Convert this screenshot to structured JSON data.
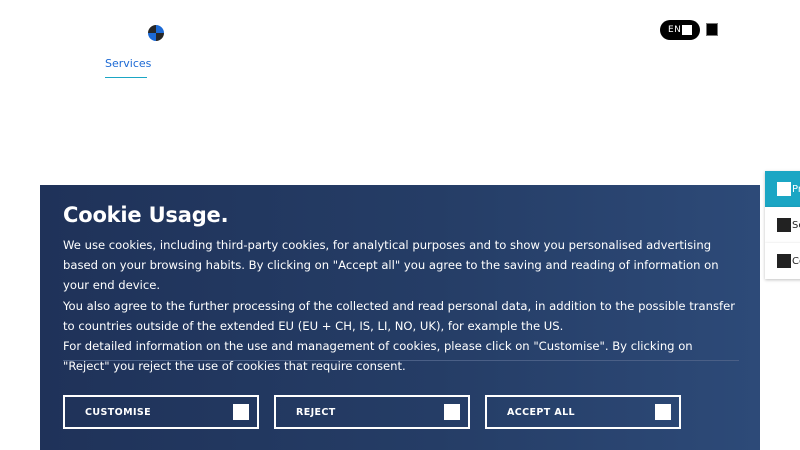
{
  "header": {
    "logo_icon": "bmw-roundel-icon",
    "nav": {
      "services": "Services"
    },
    "language": {
      "label": "EN"
    },
    "cart_icon": "bag-icon"
  },
  "side_tabs": [
    {
      "label": "Pr",
      "active": true
    },
    {
      "label": "Se",
      "active": false
    },
    {
      "label": "Co",
      "active": false
    }
  ],
  "cookie_banner": {
    "title": "Cookie Usage.",
    "paragraphs": [
      "We use cookies, including third-party cookies, for analytical purposes and to show you personalised advertising based on your browsing habits. By clicking on \"Accept all\" you agree to the saving and reading of information on your end device.",
      "You also agree to the further processing of the collected and read personal data, in addition to the possible transfer to countries outside of the extended EU (EU + CH, IS, LI, NO, UK), for example the US.",
      "For detailed information on the use and management of cookies, please click on \"Customise\". By clicking on \"Reject\" you reject the use of cookies that require consent."
    ],
    "buttons": {
      "customise": "CUSTOMISE",
      "reject": "REJECT",
      "accept_all": "ACCEPT ALL"
    }
  },
  "colors": {
    "accent": "#1ba6c4",
    "link": "#1c69d4",
    "banner_bg": "#253d66"
  }
}
